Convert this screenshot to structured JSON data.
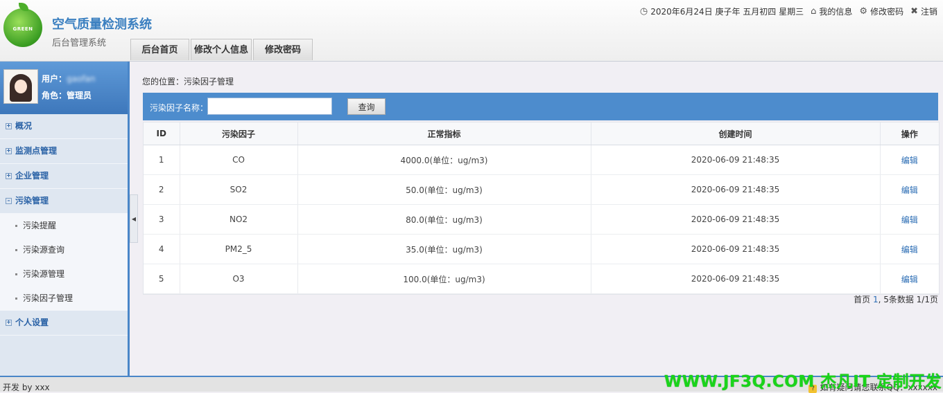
{
  "header": {
    "logo_text": "GREEN",
    "title": "空气质量检测系统",
    "subtitle": "后台管理系统",
    "tabs": [
      {
        "label": "后台首页"
      },
      {
        "label": "修改个人信息"
      },
      {
        "label": "修改密码"
      }
    ],
    "datetime": "2020年6月24日 庚子年 五月初四 星期三",
    "my_info": "我的信息",
    "change_password": "修改密码",
    "logout": "注销"
  },
  "sidebar": {
    "user_label": "用户：",
    "user_value": "gaofan",
    "role_label": "角色：",
    "role_value": "管理员",
    "menu": [
      {
        "label": "概况",
        "sign": "⊞"
      },
      {
        "label": "监测点管理",
        "sign": "⊞"
      },
      {
        "label": "企业管理",
        "sign": "⊞"
      },
      {
        "label": "污染管理",
        "sign": "⊟"
      }
    ],
    "sub_items": [
      {
        "label": "污染提醒"
      },
      {
        "label": "污染源查询"
      },
      {
        "label": "污染源管理"
      },
      {
        "label": "污染因子管理"
      }
    ],
    "last_menu": {
      "label": "个人设置",
      "sign": "⊞"
    }
  },
  "main": {
    "breadcrumb": "您的位置：污染因子管理",
    "search_label": "污染因子名称：",
    "search_value": "",
    "search_button": "查询",
    "table": {
      "headers": [
        "ID",
        "污染因子",
        "正常指标",
        "创建时间",
        "操作"
      ],
      "rows": [
        [
          "1",
          "CO",
          "4000.0(单位：ug/m3)",
          "2020-06-09 21:48:35",
          "编辑"
        ],
        [
          "2",
          "SO2",
          "50.0(单位：ug/m3)",
          "2020-06-09 21:48:35",
          "编辑"
        ],
        [
          "3",
          "NO2",
          "80.0(单位：ug/m3)",
          "2020-06-09 21:48:35",
          "编辑"
        ],
        [
          "4",
          "PM2_5",
          "35.0(单位：ug/m3)",
          "2020-06-09 21:48:35",
          "编辑"
        ],
        [
          "5",
          "O3",
          "100.0(单位：ug/m3)",
          "2020-06-09 21:48:35",
          "编辑"
        ]
      ]
    },
    "pagination": {
      "first": "首页",
      "current": "1",
      "summary": ", 5条数据 1/1页"
    }
  },
  "footer": {
    "left": "开发 by xxx",
    "right": "如有疑问请您联系QQ：xxxxxx",
    "watermark": "WWW.JF3Q.COM 杰凡IT  定制开发"
  }
}
